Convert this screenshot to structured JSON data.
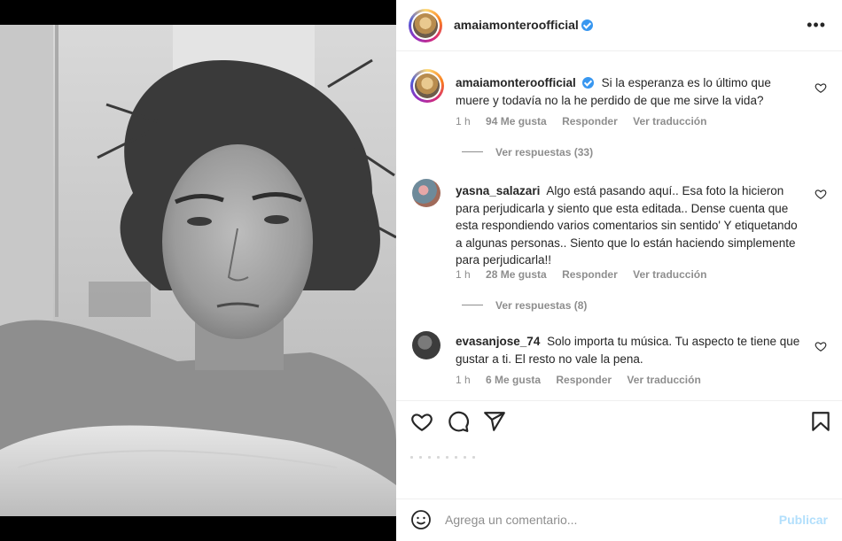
{
  "post": {
    "author": "amaiamonteroofficial",
    "more_glyph": "•••"
  },
  "comments": [
    {
      "user": "amaiamonteroofficial",
      "verified": true,
      "text": "Si la esperanza es lo último que muere y todavía no la he perdido de que me sirve la vida?",
      "time": "1 h",
      "likes": "94 Me gusta",
      "reply": "Responder",
      "translate": "Ver traducción",
      "replies": "Ver respuestas (33)"
    },
    {
      "user": "yasna_salazari",
      "verified": false,
      "text": "Algo está pasando aquí.. Esa foto la hicieron para perjudicarla y siento que esta editada.. Dense cuenta que esta respondiendo varios comentarios sin sentido' Y etiquetando a algunas personas.. Siento que lo están haciendo simplemente para perjudicarla!!",
      "time": "1 h",
      "likes": "28 Me gusta",
      "reply": "Responder",
      "translate": "Ver traducción",
      "replies": "Ver respuestas (8)"
    },
    {
      "user": "evasanjose_74",
      "verified": false,
      "text": "Solo importa tu música. Tu aspecto te tiene que gustar a ti. El resto no vale la pena.",
      "time": "1 h",
      "likes": "6 Me gusta",
      "reply": "Responder",
      "translate": "Ver traducción"
    }
  ],
  "actions": {
    "icons": [
      "heart-icon",
      "comment-icon",
      "share-icon",
      "bookmark-icon"
    ]
  },
  "add_comment": {
    "placeholder": "Agrega un comentario...",
    "publish": "Publicar"
  },
  "colors": {
    "accent": "#3897f0",
    "publish_disabled": "#b2dffc",
    "muted": "#8e8e8e"
  }
}
